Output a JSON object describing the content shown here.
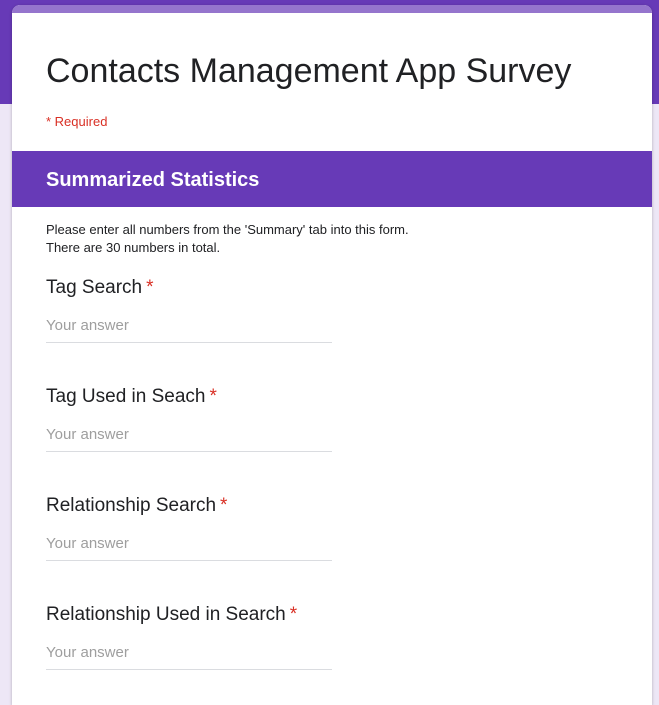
{
  "form": {
    "title": "Contacts Management App Survey",
    "required_note": "* Required"
  },
  "section": {
    "title": "Summarized Statistics",
    "description_lines": [
      "Please enter all numbers from the 'Summary' tab into this form.",
      "There are 30 numbers in total."
    ]
  },
  "questions": [
    {
      "label": "Tag Search",
      "required_mark": "*",
      "placeholder": "Your answer",
      "value": ""
    },
    {
      "label": "Tag Used in Seach",
      "required_mark": "*",
      "placeholder": "Your answer",
      "value": ""
    },
    {
      "label": "Relationship Search",
      "required_mark": "*",
      "placeholder": "Your answer",
      "value": ""
    },
    {
      "label": "Relationship Used in Search",
      "required_mark": "*",
      "placeholder": "Your answer",
      "value": ""
    }
  ],
  "colors": {
    "brand": "#673ab7",
    "accent": "#9575cd",
    "required": "#d93025",
    "background": "#ede7f6"
  }
}
